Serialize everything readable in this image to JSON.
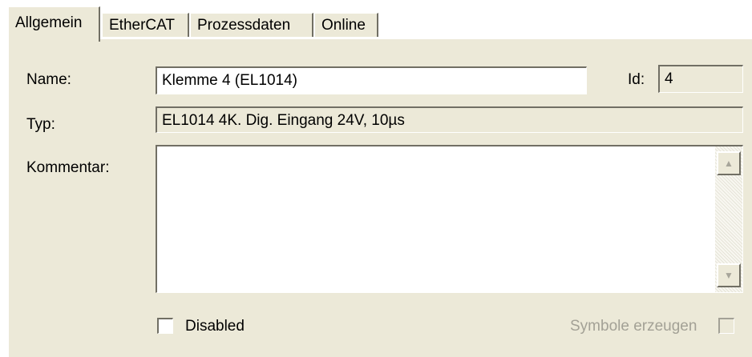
{
  "tabs": [
    {
      "label": "Allgemein"
    },
    {
      "label": "EtherCAT"
    },
    {
      "label": "Prozessdaten"
    },
    {
      "label": "Online"
    }
  ],
  "general": {
    "name_label": "Name:",
    "name_value": "Klemme 4 (EL1014)",
    "id_label": "Id:",
    "id_value": "4",
    "type_label": "Typ:",
    "type_value": "EL1014 4K. Dig. Eingang 24V, 10µs",
    "comment_label": "Kommentar:",
    "comment_value": "",
    "disabled_label": "Disabled",
    "disabled_checked": false,
    "symbols_label": "Symbole erzeugen",
    "symbols_checked": false,
    "symbols_enabled": false
  },
  "icons": {
    "scroll_up": "scroll-up-icon",
    "scroll_down": "scroll-down-icon"
  },
  "colors": {
    "panel_bg": "#ece9d8",
    "border_dark": "#716f64",
    "disabled_text": "#a3a196"
  }
}
